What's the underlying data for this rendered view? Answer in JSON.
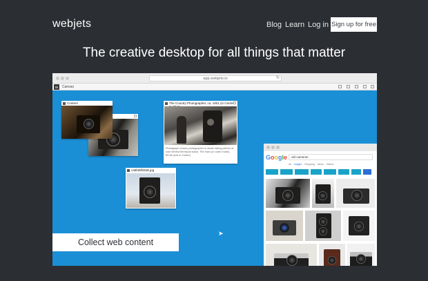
{
  "nav": {
    "logo": "webjets",
    "links": [
      "Blog",
      "Learn",
      "Log in"
    ],
    "signup": "Sign up for free"
  },
  "headline": "The creative desktop for all things that matter",
  "browser": {
    "url": "app.webjets.io",
    "toolbar_badge": "W",
    "board_title": "Canvas"
  },
  "cards": {
    "content_title": "Content",
    "photo_title": "The Country Photographer, ca. 1901 (in Centre, North D...",
    "photo_caption": "Photograph shows photographer in studio taking picture of man behind the tripod stand. The man (on outer mode), $3.38 (sort in Centre)",
    "file_title": "ca5bd9fd2ab.jpg"
  },
  "google": {
    "search_text": "old cameras",
    "tabs": [
      "All",
      "Images",
      "Shopping",
      "News",
      "Videos"
    ]
  },
  "overlay": {
    "collect": "Collect web content"
  },
  "colors": {
    "page_bg": "#2b2e33",
    "canvas_blue": "#1a8fd6",
    "chip_teal": "#1aa3c8"
  }
}
